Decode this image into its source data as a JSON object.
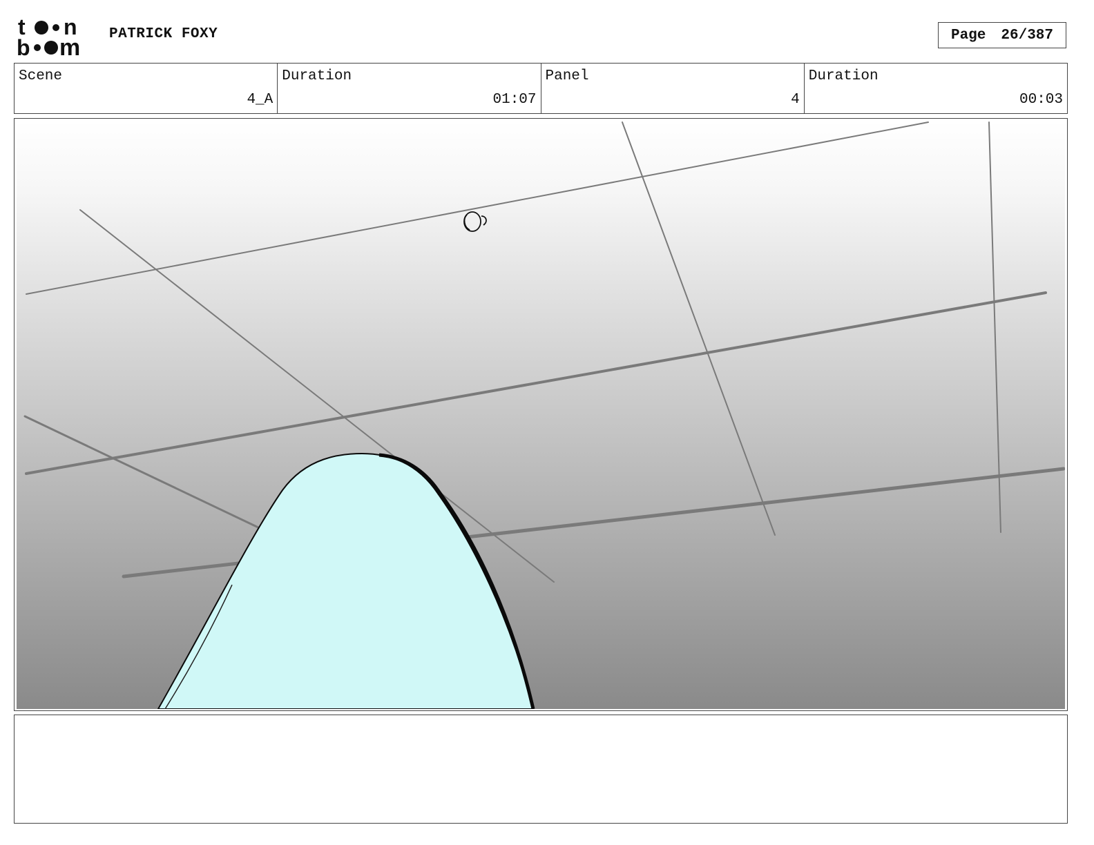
{
  "header": {
    "logo_top": "t",
    "logo_top_end": "n",
    "logo_bottom": "b",
    "logo_bottom_end": "m",
    "project_title": "PATRICK FOXY",
    "page_label": "Page",
    "page_number": "26/387"
  },
  "info": {
    "scene_label": "Scene",
    "scene_value": "4_A",
    "scene_duration_label": "Duration",
    "scene_duration_value": "01:07",
    "panel_label": "Panel",
    "panel_value": "4",
    "panel_duration_label": "Duration",
    "panel_duration_value": "00:03"
  },
  "drawing": {
    "background_top": "#ffffff",
    "background_bottom": "#8a8a8a",
    "shape_fill": "#d0f8f7",
    "line_color": "#7a7a7a",
    "outline_color": "#0a0a0a"
  },
  "notes": {}
}
